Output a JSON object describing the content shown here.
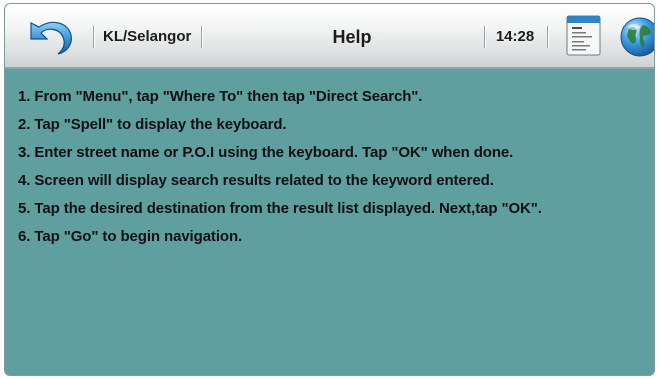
{
  "header": {
    "region": "KL/Selangor",
    "title": "Help",
    "time": "14:28",
    "icons": {
      "back": "back-arrow-icon",
      "menu": "document-menu-icon",
      "globe": "globe-icon"
    }
  },
  "steps": [
    "1. From \"Menu\", tap \"Where To\"  then tap \"Direct Search\".",
    "2. Tap \"Spell\" to display the keyboard.",
    "3. Enter street name or P.O.I using the keyboard. Tap \"OK\" when done.",
    "4. Screen will display search results related to the keyword entered.",
    "5. Tap the desired destination from the result list displayed. Next,tap \"OK\".",
    "6. Tap \"Go\" to begin navigation."
  ],
  "colors": {
    "background": "#5f9fa0",
    "header": "#e1e4e4",
    "accent_blue": "#2f84c9"
  }
}
